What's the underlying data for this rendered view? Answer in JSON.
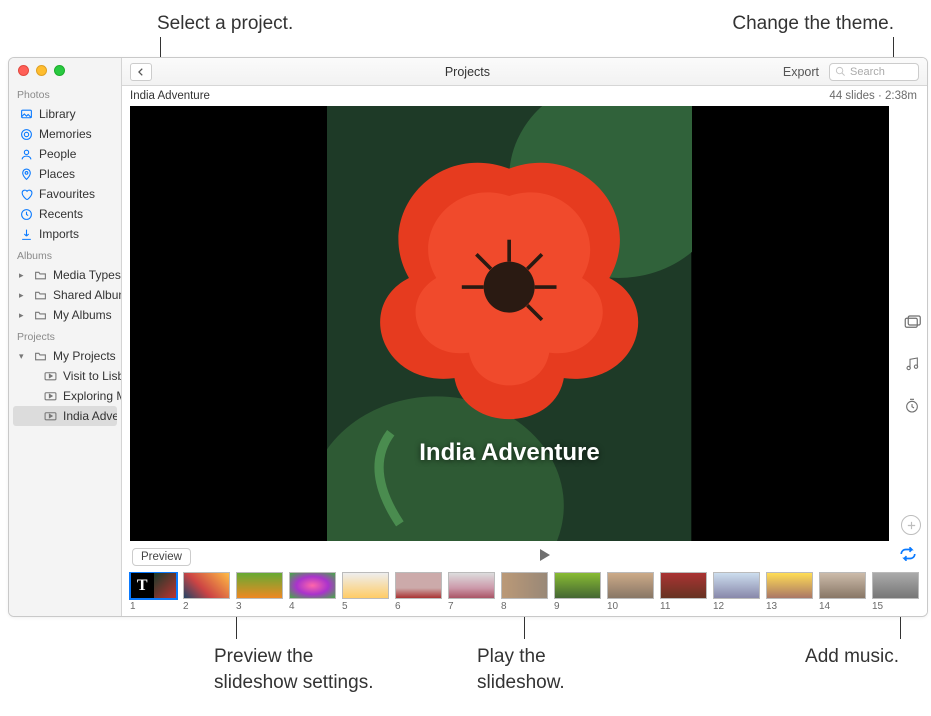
{
  "callouts": {
    "select_project": "Select a project.",
    "change_theme": "Change the theme.",
    "preview_settings": "Preview the\nslideshow settings.",
    "play_slideshow": "Play the\nslideshow.",
    "add_music": "Add music."
  },
  "toolbar": {
    "title": "Projects",
    "export": "Export",
    "search_placeholder": "Search"
  },
  "subheader": {
    "title": "India Adventure",
    "info": "44 slides · 2:38m"
  },
  "sidebar": {
    "sections": {
      "photos_header": "Photos",
      "albums_header": "Albums",
      "projects_header": "Projects"
    },
    "photos": [
      {
        "label": "Library",
        "icon": "library"
      },
      {
        "label": "Memories",
        "icon": "memories"
      },
      {
        "label": "People",
        "icon": "people"
      },
      {
        "label": "Places",
        "icon": "places"
      },
      {
        "label": "Favourites",
        "icon": "heart"
      },
      {
        "label": "Recents",
        "icon": "clock"
      },
      {
        "label": "Imports",
        "icon": "download"
      }
    ],
    "albums": [
      {
        "label": "Media Types"
      },
      {
        "label": "Shared Albums"
      },
      {
        "label": "My Albums"
      }
    ],
    "projects_group": {
      "label": "My Projects"
    },
    "projects": [
      {
        "label": "Visit to Lisbon"
      },
      {
        "label": "Exploring Mor…"
      },
      {
        "label": "India Adventure",
        "selected": true
      }
    ]
  },
  "preview": {
    "caption": "India Adventure"
  },
  "controls": {
    "preview": "Preview"
  },
  "thumbs": [
    {
      "n": "1",
      "title": true
    },
    {
      "n": "2"
    },
    {
      "n": "3"
    },
    {
      "n": "4"
    },
    {
      "n": "5"
    },
    {
      "n": "6"
    },
    {
      "n": "7"
    },
    {
      "n": "8"
    },
    {
      "n": "9"
    },
    {
      "n": "10"
    },
    {
      "n": "11"
    },
    {
      "n": "12"
    },
    {
      "n": "13"
    },
    {
      "n": "14"
    },
    {
      "n": "15"
    }
  ]
}
